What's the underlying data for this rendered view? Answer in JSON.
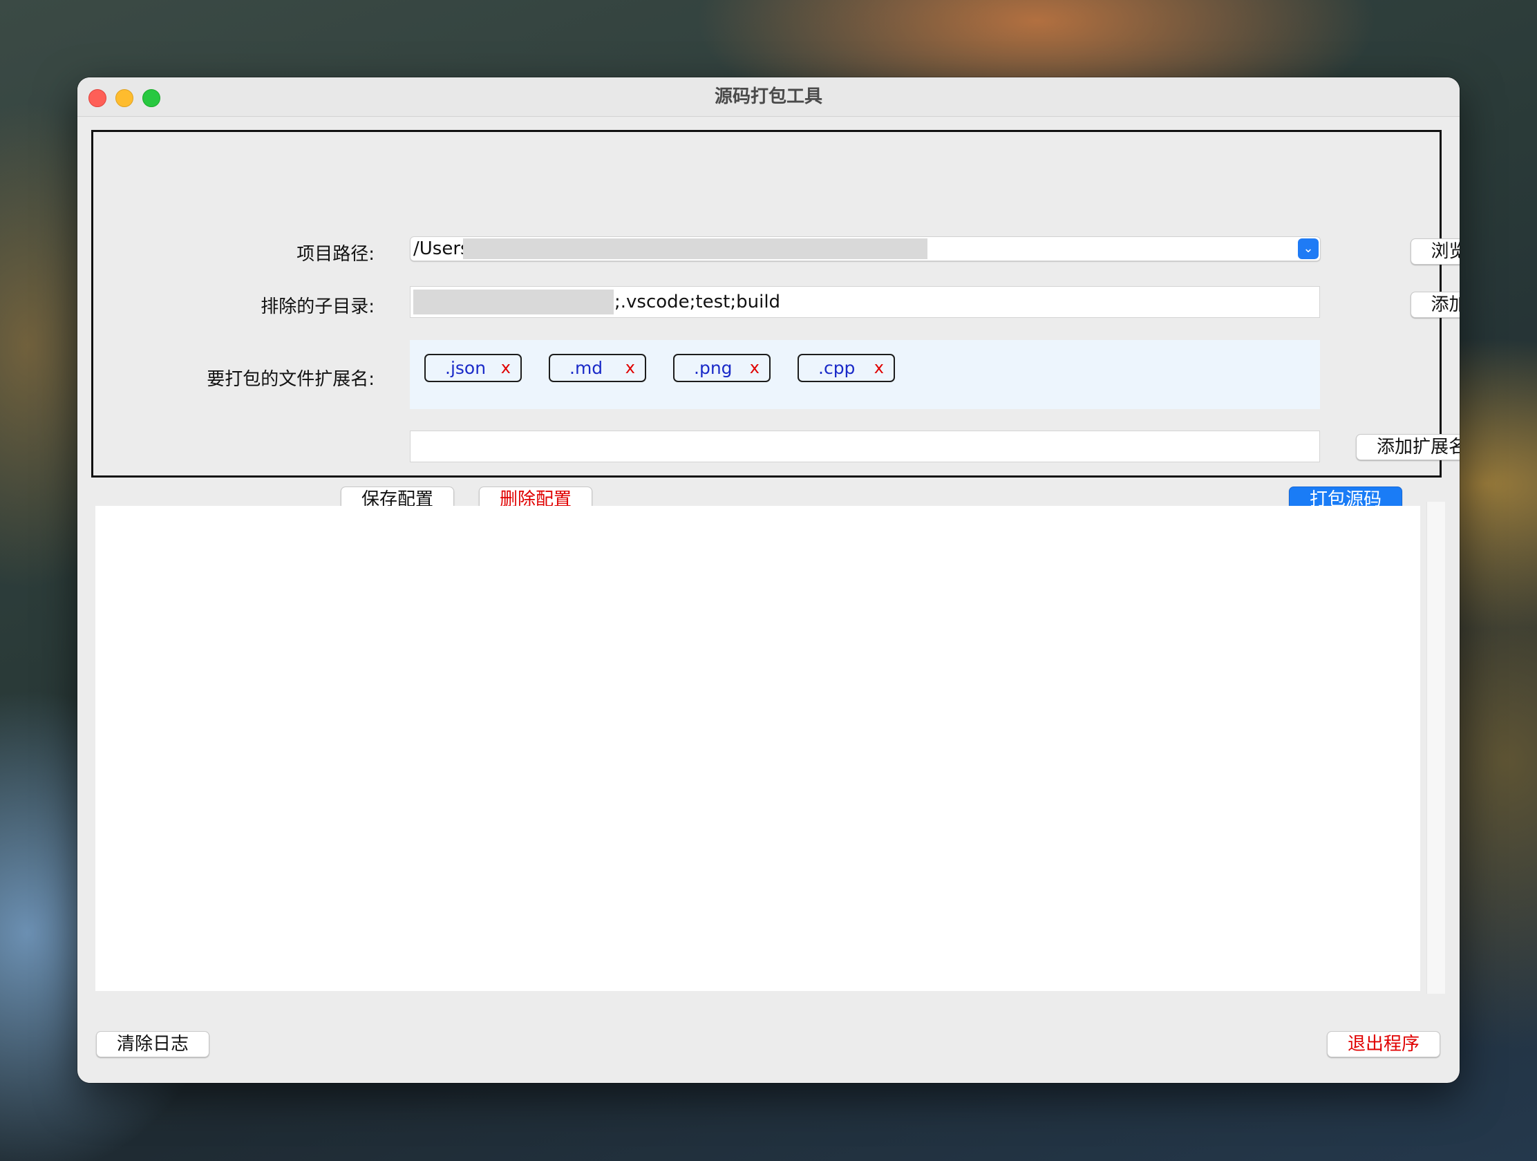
{
  "window": {
    "title": "源码打包工具"
  },
  "form": {
    "project_path_label": "项目路径:",
    "project_path_value": "/Users",
    "browse_button": "浏览",
    "exclude_label": "排除的子目录:",
    "exclude_value": ";.vscode;test;build",
    "add_button": "添加",
    "extensions_label": "要打包的文件扩展名:",
    "extensions": [
      {
        "name": ".json",
        "remove": "x"
      },
      {
        "name": ".md",
        "remove": "x"
      },
      {
        "name": ".png",
        "remove": "x"
      },
      {
        "name": ".cpp",
        "remove": "x"
      }
    ],
    "new_extension_value": "",
    "add_extension_button": "添加扩展名",
    "save_config_button": "保存配置",
    "delete_config_button": "删除配置",
    "package_button": "打包源码"
  },
  "log": {
    "content": ""
  },
  "footer": {
    "clear_log_button": "清除日志",
    "exit_button": "退出程序"
  },
  "colors": {
    "primary_button": "#1a7cf6",
    "danger_text": "#e00000",
    "tag_text": "#1a2ac8",
    "tag_area_bg": "#edf5fd"
  }
}
